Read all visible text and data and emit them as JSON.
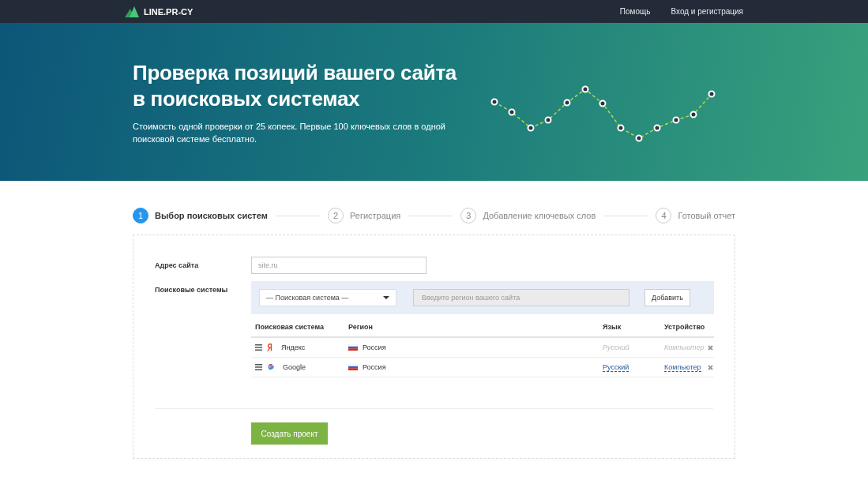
{
  "nav": {
    "logo": "LINE.PR-CY",
    "links": [
      "Помощь",
      "Вход и регистрация"
    ]
  },
  "hero": {
    "title": "Проверка позиций вашего сайта в поисковых системах",
    "subtitle": "Стоимость одной проверки от 25 копеек. Первые 100 ключевых слов в одной поисковой системе бесплатно."
  },
  "steps": [
    {
      "number": "1",
      "label": "Выбор поисковых систем",
      "selected": true
    },
    {
      "number": "2",
      "label": "Регистрация",
      "selected": false
    },
    {
      "number": "3",
      "label": "Добавление ключевых слов",
      "selected": false
    },
    {
      "number": "4",
      "label": "Готовый отчет",
      "selected": false
    }
  ],
  "form": {
    "address_label": "Адрес сайта",
    "address_placeholder": "site.ru",
    "engines_label": "Поисковые системы",
    "engine_select": "— Поисковая система —",
    "region_placeholder": "Введите регион вашего сайта",
    "add_button": "Добавить",
    "columns": [
      "Поисковая система",
      "Регион",
      "Язык",
      "Устройство"
    ],
    "rows": [
      {
        "kind": "yandex",
        "engine": "Яндекс",
        "region": "Россия",
        "language": "Русский",
        "device": "Компьютер",
        "disabled": true
      },
      {
        "kind": "google",
        "engine": "Google",
        "region": "Россия",
        "language": "Русский",
        "device": "Компьютер",
        "disabled": false
      }
    ],
    "submit": "Создать проект"
  }
}
